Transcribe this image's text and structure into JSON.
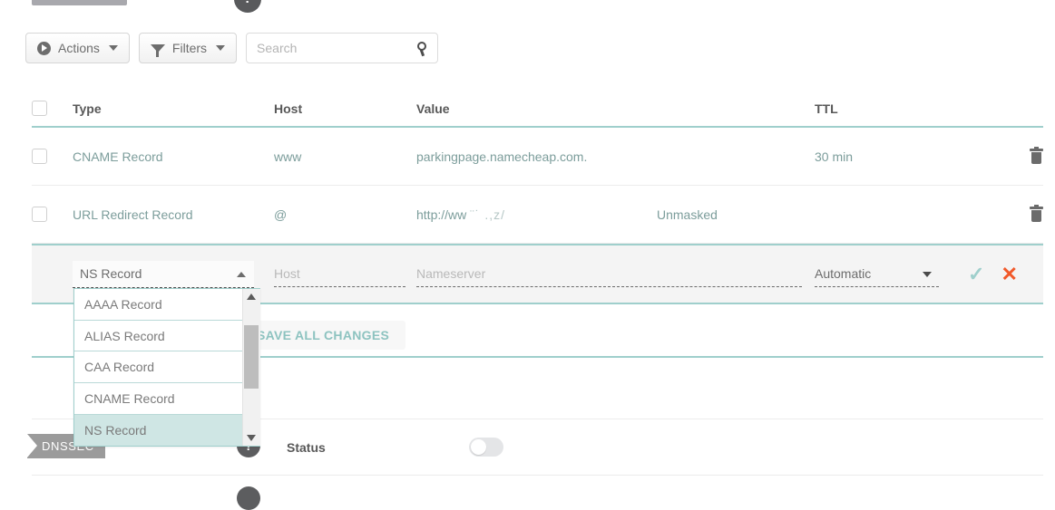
{
  "toolbar": {
    "actions_label": "Actions",
    "filters_label": "Filters",
    "search_placeholder": "Search",
    "search_value": ""
  },
  "table": {
    "columns": [
      "Type",
      "Host",
      "Value",
      "TTL"
    ],
    "rows": [
      {
        "type": "CNAME Record",
        "host": "www",
        "value": "parkingpage.namecheap.com.",
        "extra": "",
        "ttl": "30 min"
      },
      {
        "type": "URL Redirect Record",
        "host": "@",
        "value": "http://ww",
        "value_redacted": "¨˙ .,z/",
        "extra": "Unmasked",
        "ttl": ""
      }
    ],
    "edit_row": {
      "type_value": "NS Record",
      "host_placeholder": "Host",
      "host_value": "",
      "value_placeholder": "Nameserver",
      "value_value": "",
      "ttl_value": "Automatic",
      "confirm_glyph": "✓",
      "cancel_glyph": "✕"
    }
  },
  "type_dropdown": {
    "open": true,
    "options": [
      "AAAA Record",
      "ALIAS Record",
      "CAA Record",
      "CNAME Record",
      "NS Record"
    ],
    "selected": "NS Record"
  },
  "save_bar": {
    "save_label": "SAVE ALL CHANGES"
  },
  "dnssec": {
    "tab_label": "DNSSEC",
    "status_label": "Status",
    "toggle_on": false,
    "help_glyph": "?"
  },
  "colors": {
    "accent_teal": "#9fcfcc",
    "link_teal": "#7c9d9b",
    "cancel_orange": "#f1592a",
    "edit_row_bg": "#f4f4f4",
    "dropdown_selected": "#cfe6e4"
  }
}
